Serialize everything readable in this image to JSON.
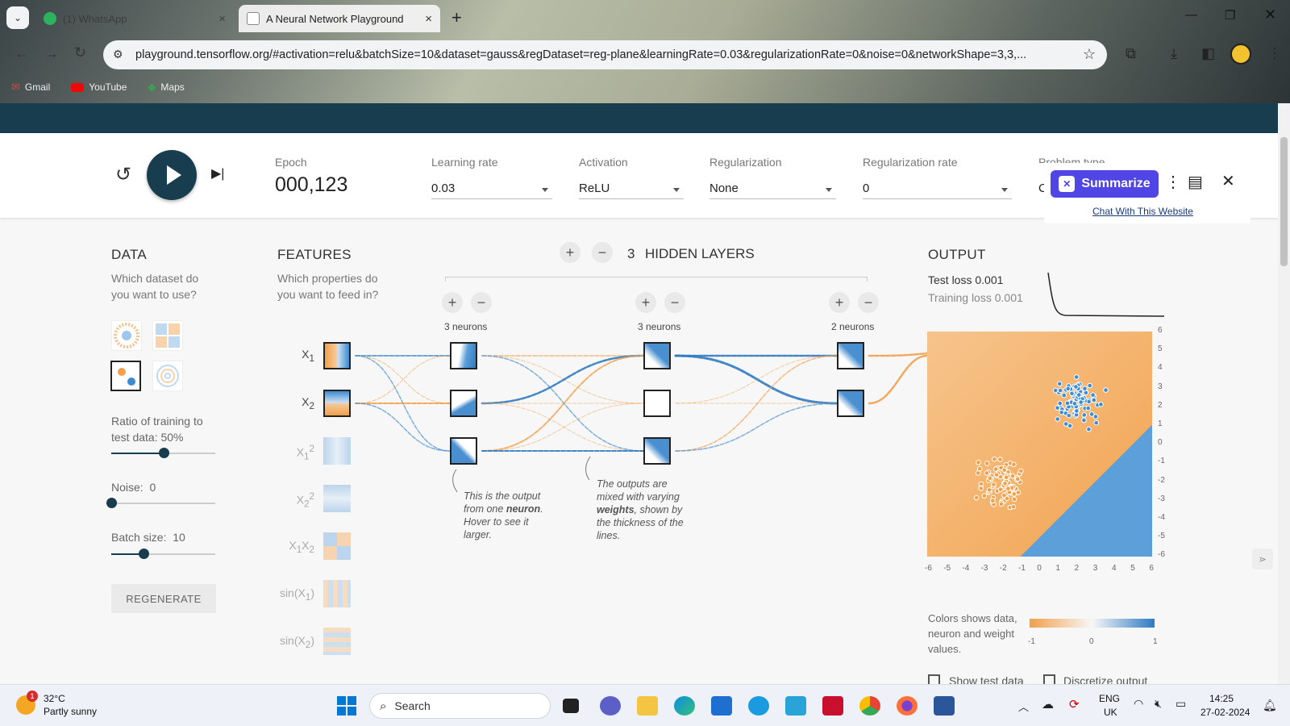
{
  "browser": {
    "tabs": [
      {
        "title": "(1) WhatsApp",
        "favicon": "whatsapp-icon"
      },
      {
        "title": "A Neural Network Playground",
        "favicon": "tensorflow-icon"
      }
    ],
    "new_tab": "+",
    "url": "playground.tensorflow.org/#activation=relu&batchSize=10&dataset=gauss&regDataset=reg-plane&learningRate=0.03&regularizationRate=0&noise=0&networkShape=3,3,...",
    "bookmarks": [
      "Gmail",
      "YouTube",
      "Maps"
    ]
  },
  "controls": {
    "epoch_label": "Epoch",
    "epoch_value": "000,123",
    "learning_rate_label": "Learning rate",
    "learning_rate_value": "0.03",
    "activation_label": "Activation",
    "activation_value": "ReLU",
    "regularization_label": "Regularization",
    "regularization_value": "None",
    "reg_rate_label": "Regularization rate",
    "reg_rate_value": "0",
    "problem_type_label": "Problem type",
    "problem_type_value": "C"
  },
  "data_panel": {
    "title": "DATA",
    "subtitle": "Which dataset do you want to use?",
    "ratio_label": "Ratio of training to test data:",
    "ratio_value": "50%",
    "ratio_fraction": 0.5,
    "noise_label": "Noise:",
    "noise_value": "0",
    "noise_fraction": 0,
    "batch_label": "Batch size:",
    "batch_value": "10",
    "batch_fraction": 0.31,
    "regenerate": "REGENERATE"
  },
  "features_panel": {
    "title": "FEATURES",
    "subtitle": "Which properties do you want to feed in?",
    "features": [
      "X1",
      "X2",
      "X1²",
      "X2²",
      "X1X2",
      "sin(X1)",
      "sin(X2)"
    ]
  },
  "network": {
    "hidden_layers_count": "3",
    "hidden_layers_label": "HIDDEN LAYERS",
    "layers": [
      {
        "neurons_label": "3 neurons"
      },
      {
        "neurons_label": "3 neurons"
      },
      {
        "neurons_label": "2 neurons"
      }
    ],
    "note1_a": "This is the output from one ",
    "note1_b": "neuron",
    "note1_c": ". Hover to see it larger.",
    "note2_a": "The outputs are mixed with varying ",
    "note2_b": "weights",
    "note2_c": ", shown by the thickness of the lines."
  },
  "output_panel": {
    "title": "OUTPUT",
    "test_loss": "Test loss 0.001",
    "training_loss": "Training loss 0.001",
    "y_ticks": [
      "6",
      "5",
      "4",
      "3",
      "2",
      "1",
      "0",
      "-1",
      "-2",
      "-3",
      "-4",
      "-5",
      "-6"
    ],
    "x_ticks": [
      "-6",
      "-5",
      "-4",
      "-3",
      "-2",
      "-1",
      "0",
      "1",
      "2",
      "3",
      "4",
      "5",
      "6"
    ],
    "legend_text": "Colors shows data, neuron and weight values.",
    "legend_ticks": [
      "-1",
      "0",
      "1"
    ],
    "show_test_data": "Show test data",
    "discretize_output": "Discretize output",
    "colors": {
      "positive": "#3d8bd0",
      "negative": "#f0a04b"
    }
  },
  "extension": {
    "summarize": "Summarize",
    "chat_link": "Chat With This Website"
  },
  "taskbar": {
    "weather_temp": "32°C",
    "weather_desc": "Partly sunny",
    "weather_badge": "1",
    "search_placeholder": "Search",
    "lang": "ENG",
    "region": "UK",
    "time": "14:25",
    "date": "27-02-2024"
  }
}
